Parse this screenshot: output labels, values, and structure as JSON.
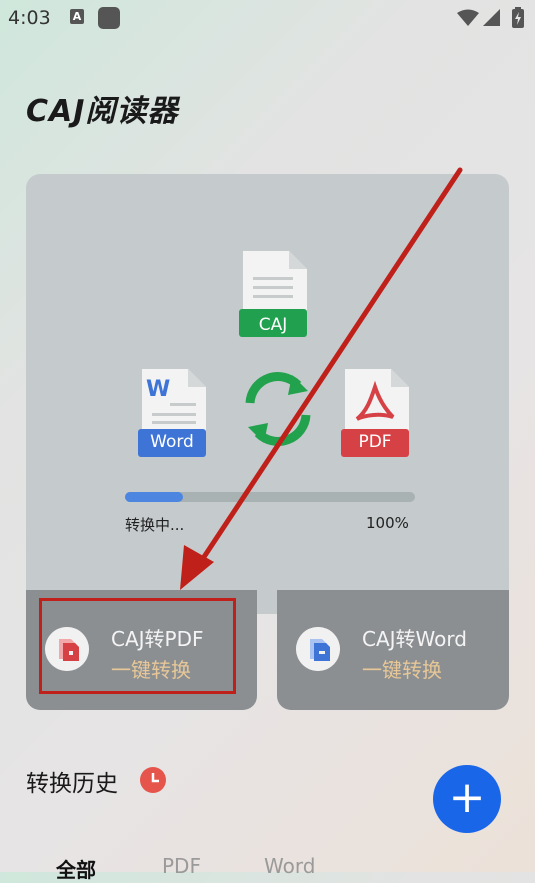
{
  "status_bar": {
    "time": "4:03",
    "notification_icon_letter": "A"
  },
  "app": {
    "title": "CAJ阅读器"
  },
  "hero": {
    "caj_label": "CAJ",
    "word_label": "Word",
    "word_letter": "W",
    "pdf_label": "PDF",
    "progress_label": "转换中...",
    "progress_percent": "100%",
    "progress_fill_fraction": 0.2
  },
  "cards": [
    {
      "title": "CAJ转PDF",
      "subtitle": "一键转换",
      "icon": "pdf-file-icon"
    },
    {
      "title": "CAJ转Word",
      "subtitle": "一键转换",
      "icon": "word-file-icon"
    }
  ],
  "history": {
    "title": "转换历史",
    "icon": "clock-icon",
    "tabs": [
      "全部",
      "PDF",
      "Word"
    ],
    "active_tab": 0
  },
  "fab": {
    "label": "+"
  },
  "colors": {
    "accent_blue": "#1a66e8",
    "caj_green": "#21a04f",
    "pdf_red": "#d64146",
    "word_blue": "#3e74d6",
    "annotation_red": "#c0201a",
    "subtitle_gold": "#e7c797"
  }
}
